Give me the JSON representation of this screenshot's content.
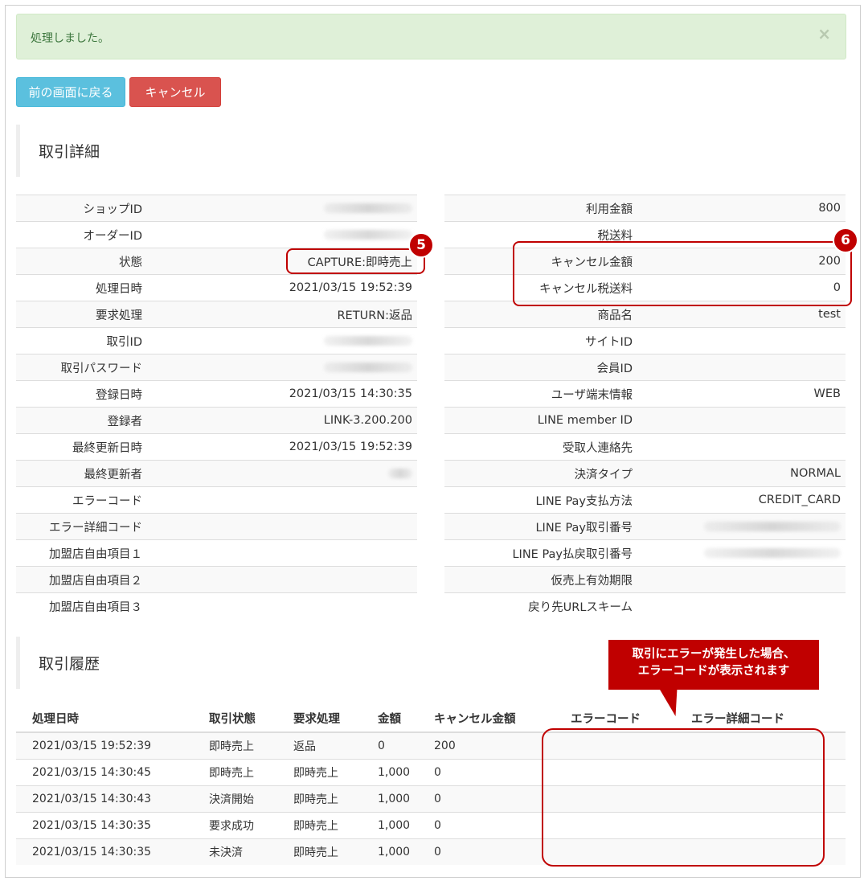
{
  "alert": {
    "message": "処理しました。",
    "close_label": "×"
  },
  "buttons": {
    "back_label": "前の画面に戻る",
    "cancel_label": "キャンセル"
  },
  "detail_title": "取引詳細",
  "history_title": "取引履歴",
  "detail_left": [
    {
      "label": "ショップID",
      "value": "",
      "redacted": true
    },
    {
      "label": "オーダーID",
      "value": "",
      "redacted": true
    },
    {
      "label": "状態",
      "value": "CAPTURE:即時売上"
    },
    {
      "label": "処理日時",
      "value": "2021/03/15 19:52:39"
    },
    {
      "label": "要求処理",
      "value": "RETURN:返品"
    },
    {
      "label": "取引ID",
      "value": "",
      "redacted": true
    },
    {
      "label": "取引パスワード",
      "value": "",
      "redacted": true
    },
    {
      "label": "登録日時",
      "value": "2021/03/15 14:30:35"
    },
    {
      "label": "登録者",
      "value": "LINK-3.200.200"
    },
    {
      "label": "最終更新日時",
      "value": "2021/03/15 19:52:39"
    },
    {
      "label": "最終更新者",
      "value": "",
      "redacted": true
    },
    {
      "label": "エラーコード",
      "value": ""
    },
    {
      "label": "エラー詳細コード",
      "value": ""
    },
    {
      "label": "加盟店自由項目１",
      "value": ""
    },
    {
      "label": "加盟店自由項目２",
      "value": ""
    },
    {
      "label": "加盟店自由項目３",
      "value": ""
    }
  ],
  "detail_right": [
    {
      "label": "利用金額",
      "value": "800"
    },
    {
      "label": "税送料",
      "value": ""
    },
    {
      "label": "キャンセル金額",
      "value": "200"
    },
    {
      "label": "キャンセル税送料",
      "value": "0"
    },
    {
      "label": "商品名",
      "value": "test"
    },
    {
      "label": "サイトID",
      "value": ""
    },
    {
      "label": "会員ID",
      "value": ""
    },
    {
      "label": "ユーザ端末情報",
      "value": "WEB"
    },
    {
      "label": "LINE member ID",
      "value": ""
    },
    {
      "label": "受取人連絡先",
      "value": ""
    },
    {
      "label": "決済タイプ",
      "value": "NORMAL"
    },
    {
      "label": "LINE Pay支払方法",
      "value": "CREDIT_CARD"
    },
    {
      "label": "LINE Pay取引番号",
      "value": "",
      "redacted": true
    },
    {
      "label": "LINE Pay払戻取引番号",
      "value": "",
      "redacted": true
    },
    {
      "label": "仮売上有効期限",
      "value": ""
    },
    {
      "label": "戻り先URLスキーム",
      "value": ""
    }
  ],
  "history": {
    "columns": [
      "処理日時",
      "取引状態",
      "要求処理",
      "金額",
      "キャンセル金額",
      "エラーコード",
      "エラー詳細コード"
    ],
    "rows": [
      [
        "2021/03/15 19:52:39",
        "即時売上",
        "返品",
        "0",
        "200",
        "",
        ""
      ],
      [
        "2021/03/15 14:30:45",
        "即時売上",
        "即時売上",
        "1,000",
        "0",
        "",
        ""
      ],
      [
        "2021/03/15 14:30:43",
        "決済開始",
        "即時売上",
        "1,000",
        "0",
        "",
        ""
      ],
      [
        "2021/03/15 14:30:35",
        "要求成功",
        "即時売上",
        "1,000",
        "0",
        "",
        ""
      ],
      [
        "2021/03/15 14:30:35",
        "未決済",
        "即時売上",
        "1,000",
        "0",
        "",
        ""
      ]
    ]
  },
  "annotations": {
    "badge5": "5",
    "badge6": "6",
    "callout_line1": "取引にエラーが発生した場合、",
    "callout_line2": "エラーコードが表示されます"
  },
  "colors": {
    "accent_red": "#c00000",
    "success_bg": "#dff0d8",
    "info_btn": "#5bc0de",
    "danger_btn": "#d9534f"
  }
}
